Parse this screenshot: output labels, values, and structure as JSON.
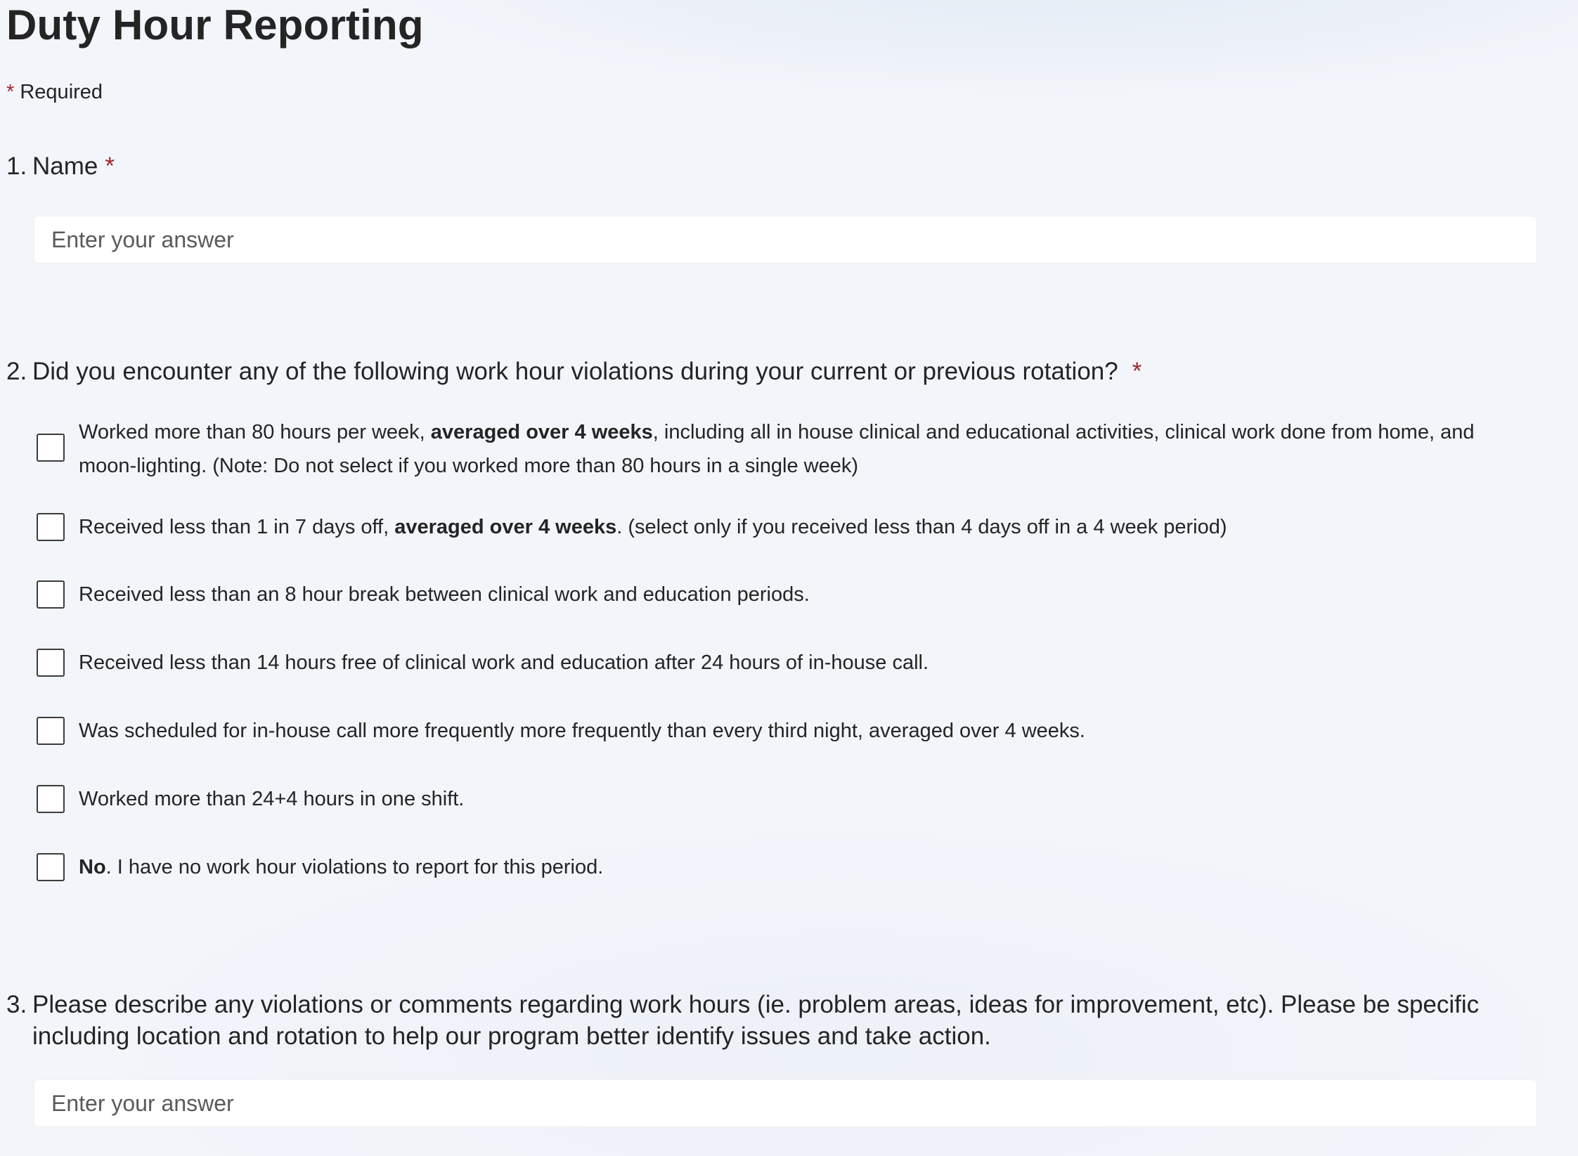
{
  "form": {
    "title": "Duty Hour Reporting",
    "required_marker": "*",
    "required_label": "Required"
  },
  "questions": [
    {
      "number": "1.",
      "title": "Name",
      "required_marker": "*",
      "input_placeholder": "Enter your answer"
    },
    {
      "number": "2.",
      "title": "Did you encounter any of the following work hour violations during your current or previous rotation?",
      "required_marker": "*",
      "options": [
        {
          "before": "Worked more than 80 hours per week, ",
          "bold": "averaged over 4 weeks",
          "after": ", including all in house clinical and educational activities, clinical work done from home, and moon-lighting. (Note: Do not select if you worked more than 80 hours in a single week)",
          "checked": false
        },
        {
          "before": "Received less than 1 in 7 days off, ",
          "bold": "averaged over 4 weeks",
          "after": ". (select only if you received less than 4 days off in a 4 week period)",
          "checked": false
        },
        {
          "before": "Received less than an 8 hour break between clinical work and education periods.",
          "checked": false
        },
        {
          "before": "Received less than 14 hours free of clinical work and education after 24 hours of in-house call.",
          "checked": false
        },
        {
          "before": "Was scheduled for in-house call more frequently more frequently than every third night, averaged over 4 weeks.",
          "checked": false
        },
        {
          "before": "Worked more than 24+4 hours in one shift.",
          "checked": false
        },
        {
          "before": "",
          "bold": "No",
          "after": ". I have no work hour violations to report for this period.",
          "checked": false
        }
      ]
    },
    {
      "number": "3.",
      "title": "Please describe any violations or comments regarding work hours (ie. problem areas, ideas for improvement, etc). Please be specific including location and rotation to help our program better identify issues and take action.",
      "input_placeholder": "Enter your answer"
    }
  ],
  "colors": {
    "required_asterisk": "#a4262c",
    "text": "#242424",
    "background": "#f2f5fa",
    "input_background": "#ffffff"
  }
}
